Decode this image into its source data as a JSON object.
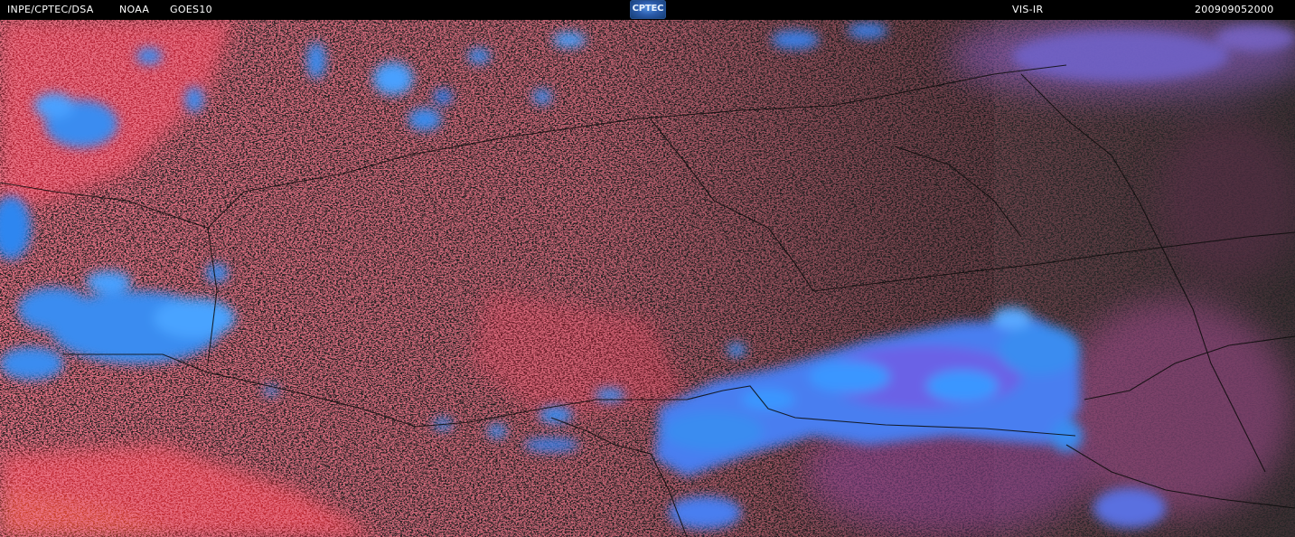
{
  "header": {
    "source": "INPE/CPTEC/DSA",
    "agency": "NOAA",
    "satellite": "GOES10",
    "channel": "VIS-IR",
    "timestamp": "200909052000"
  },
  "logo": {
    "text": "CPTEC"
  },
  "colors": {
    "background": "#1f1f1f",
    "land_red": "#d4283a",
    "cloud_blue": "#2f8cff",
    "cloud_violet": "#7a5ad8",
    "haze_pink": "#b04e8a",
    "border_line": "#0a0a0a"
  }
}
